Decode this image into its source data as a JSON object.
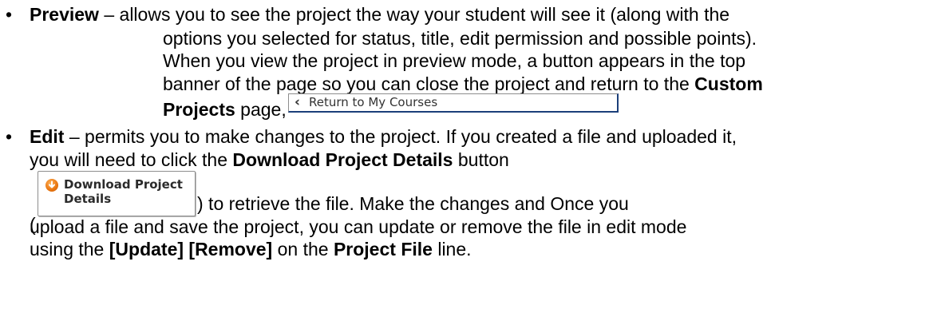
{
  "preview": {
    "term": "Preview",
    "line1": " – allows you to see the project the way your student will see it (along with the",
    "line2": "options you selected for status, title, edit permission and possible points).",
    "line3": "When you view the project in preview mode, a button appears in the top",
    "line4_pre": "banner of the page so you can close the project and return to the ",
    "line4_bold": "Custom",
    "line5_bold": "Projects",
    "line5_post": " page,",
    "button": {
      "icon": "chevron-left-icon",
      "label": "Return to My Courses"
    }
  },
  "edit": {
    "term": "Edit",
    "line1": " – permits you to make changes to the project. If you created a file and uploaded it,",
    "line2_pre": "you will need to click the ",
    "line2_bold": "Download Project Details",
    "line2_post": " button",
    "paren_open": "(",
    "line3_post": ") to retrieve the file. Make the changes and Once you",
    "line4": "upload a file and save the project, you can update or remove the file in edit mode",
    "line5_pre": "using the ",
    "line5_bold1": "[Update] [Remove]",
    "line5_mid": " on the ",
    "line5_bold2": "Project File",
    "line5_post": " line.",
    "button": {
      "icon": "download-icon",
      "label": "Download Project Details"
    }
  },
  "bullet_char": "•"
}
